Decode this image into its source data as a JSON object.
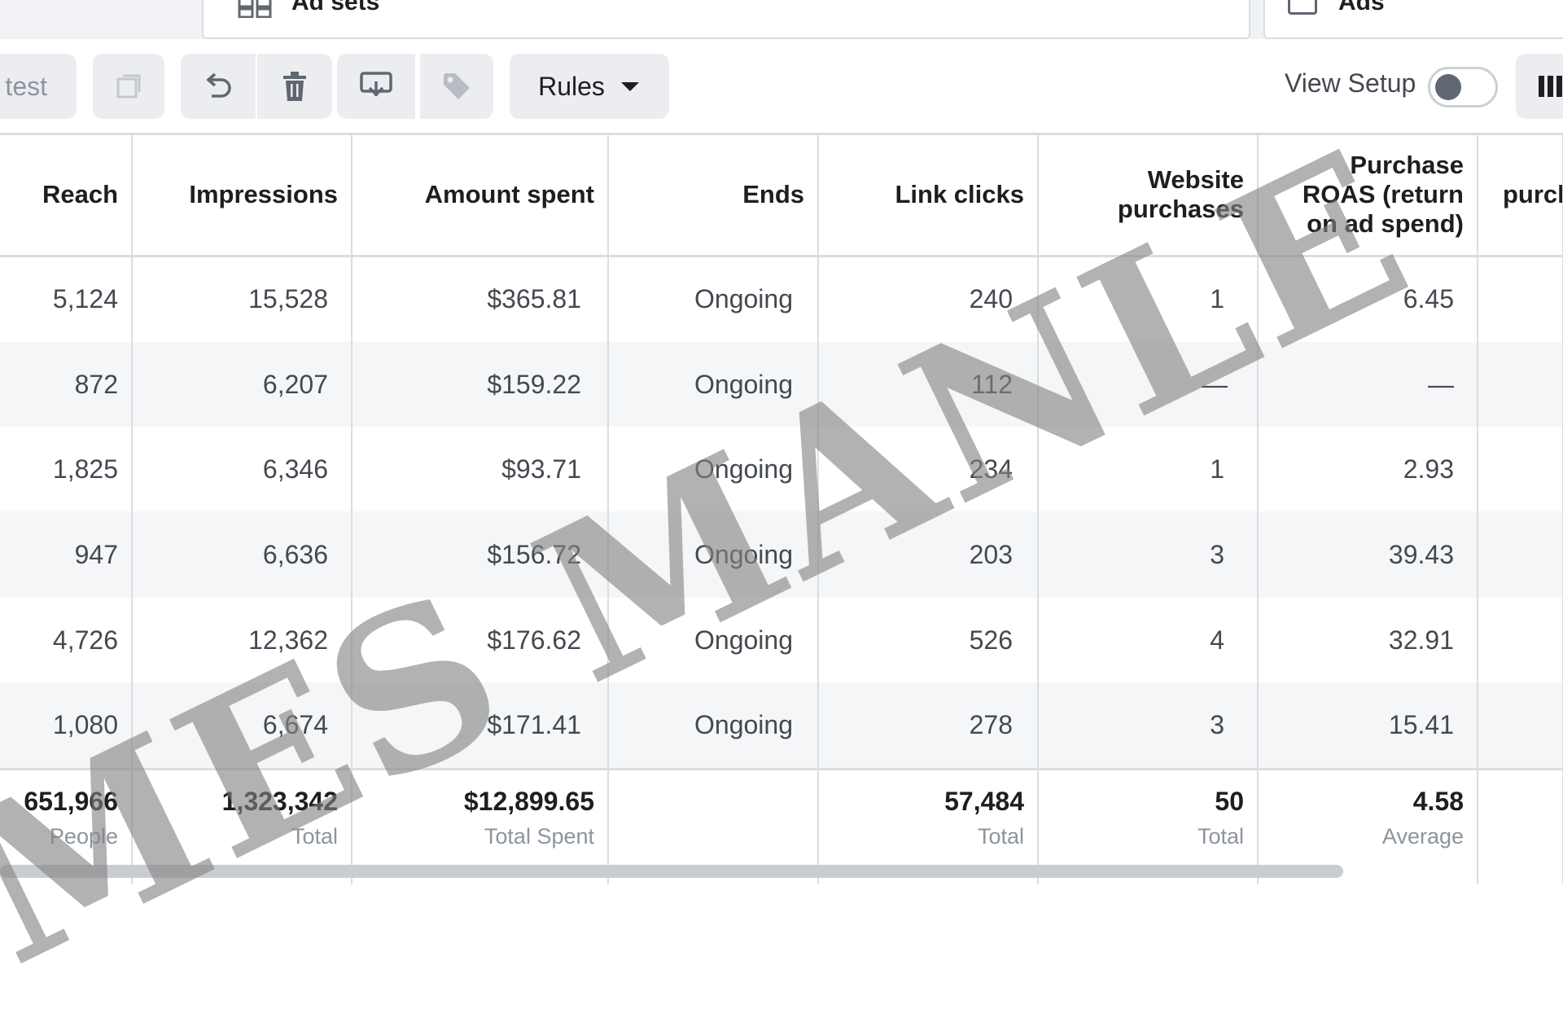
{
  "tabs": {
    "ad_sets_label": "Ad sets",
    "ads_label": "Ads"
  },
  "toolbar": {
    "ab_test_label": "test",
    "rules_label": "Rules",
    "view_setup_label": "View Setup",
    "icons": [
      "duplicate-icon",
      "undo-icon",
      "trash-icon",
      "export-icon",
      "tag-icon",
      "chevron-down-icon",
      "columns-icon"
    ]
  },
  "table": {
    "columns": [
      "Reach",
      "Impressions",
      "Amount spent",
      "Ends",
      "Link clicks",
      "Website purchases",
      "Purchase ROAS (return on ad spend)",
      "purch"
    ],
    "rows": [
      [
        "5,124",
        "15,528",
        "$365.81",
        "Ongoing",
        "240",
        "1",
        "6.45",
        ""
      ],
      [
        "872",
        "6,207",
        "$159.22",
        "Ongoing",
        "112",
        "—",
        "—",
        ""
      ],
      [
        "1,825",
        "6,346",
        "$93.71",
        "Ongoing",
        "234",
        "1",
        "2.93",
        ""
      ],
      [
        "947",
        "6,636",
        "$156.72",
        "Ongoing",
        "203",
        "3",
        "39.43",
        ""
      ],
      [
        "4,726",
        "12,362",
        "$176.62",
        "Ongoing",
        "526",
        "4",
        "32.91",
        ""
      ],
      [
        "1,080",
        "6,674",
        "$171.41",
        "Ongoing",
        "278",
        "3",
        "15.41",
        ""
      ]
    ],
    "totals": [
      {
        "value": "651,966",
        "sub": "People"
      },
      {
        "value": "1,323,342",
        "sub": "Total"
      },
      {
        "value": "$12,899.65",
        "sub": "Total Spent"
      },
      {
        "value": "",
        "sub": ""
      },
      {
        "value": "57,484",
        "sub": "Total"
      },
      {
        "value": "50",
        "sub": "Total"
      },
      {
        "value": "4.58",
        "sub": "Average"
      },
      {
        "value": "",
        "sub": ""
      }
    ]
  },
  "watermark": {
    "text": "MES MANLE"
  }
}
